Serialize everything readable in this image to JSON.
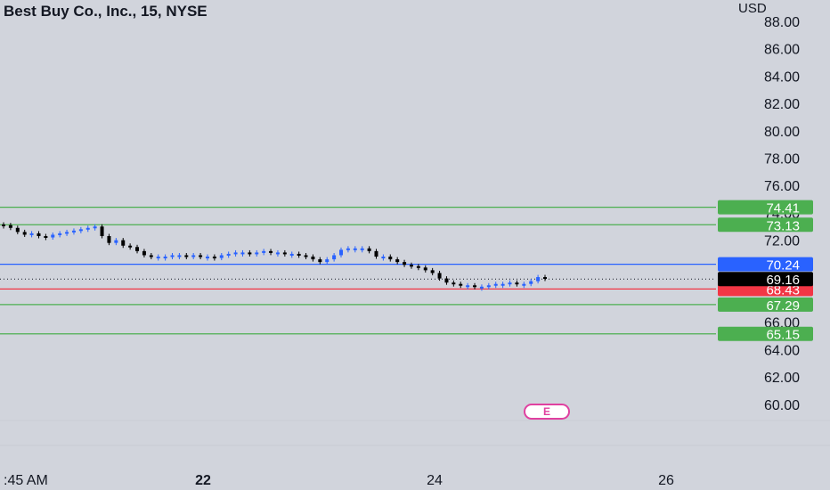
{
  "header": {
    "title": "Best Buy Co., Inc., 15, NYSE",
    "currency": "USD"
  },
  "earnings_badge": "E",
  "colors": {
    "background": "#d1d4dc",
    "support_resistance": "#4caf50",
    "pivot_line": "#2962ff",
    "stop_line": "#f23645",
    "last_price": "#000000",
    "candle_up": "#2962ff",
    "candle_down": "#000000"
  },
  "chart_data": {
    "type": "candlestick",
    "y_axis": {
      "ticks": [
        "88.00",
        "86.00",
        "84.00",
        "82.00",
        "80.00",
        "78.00",
        "76.00",
        "74.00",
        "72.00",
        "66.00",
        "64.00",
        "62.00",
        "60.00"
      ],
      "range": [
        58,
        88.4
      ],
      "side": "right"
    },
    "x_axis": {
      "tick_labels": [
        ":45 AM",
        "22",
        "24",
        "26"
      ]
    },
    "horizontal_levels": [
      {
        "value": 74.41,
        "label": "74.41",
        "kind": "resistance"
      },
      {
        "value": 73.13,
        "label": "73.13",
        "kind": "resistance"
      },
      {
        "value": 70.24,
        "label": "70.24",
        "kind": "pivot"
      },
      {
        "value": 68.43,
        "label": "68.43",
        "kind": "stop"
      },
      {
        "value": 67.29,
        "label": "67.29",
        "kind": "support"
      },
      {
        "value": 65.15,
        "label": "65.15",
        "kind": "support"
      }
    ],
    "last_price": {
      "value": 69.16,
      "label": "69.16"
    },
    "close_series": [
      73.1,
      72.9,
      72.6,
      72.4,
      72.5,
      72.3,
      72.2,
      72.4,
      72.5,
      72.6,
      72.7,
      72.8,
      72.9,
      73.0,
      72.3,
      71.8,
      72.0,
      71.6,
      71.5,
      71.2,
      70.9,
      70.8,
      70.8,
      70.8,
      70.9,
      70.9,
      70.8,
      70.9,
      70.8,
      70.8,
      70.7,
      70.9,
      71.0,
      71.1,
      71.1,
      71.0,
      71.1,
      71.2,
      71.1,
      71.1,
      71.0,
      71.0,
      70.9,
      70.8,
      70.6,
      70.4,
      70.6,
      70.9,
      71.3,
      71.4,
      71.4,
      71.4,
      71.2,
      70.8,
      70.8,
      70.6,
      70.4,
      70.2,
      70.1,
      70.0,
      69.8,
      69.6,
      69.2,
      68.9,
      68.8,
      68.7,
      68.7,
      68.6,
      68.6,
      68.7,
      68.8,
      68.8,
      68.9,
      68.8,
      68.8,
      69.0,
      69.3,
      69.2
    ]
  }
}
